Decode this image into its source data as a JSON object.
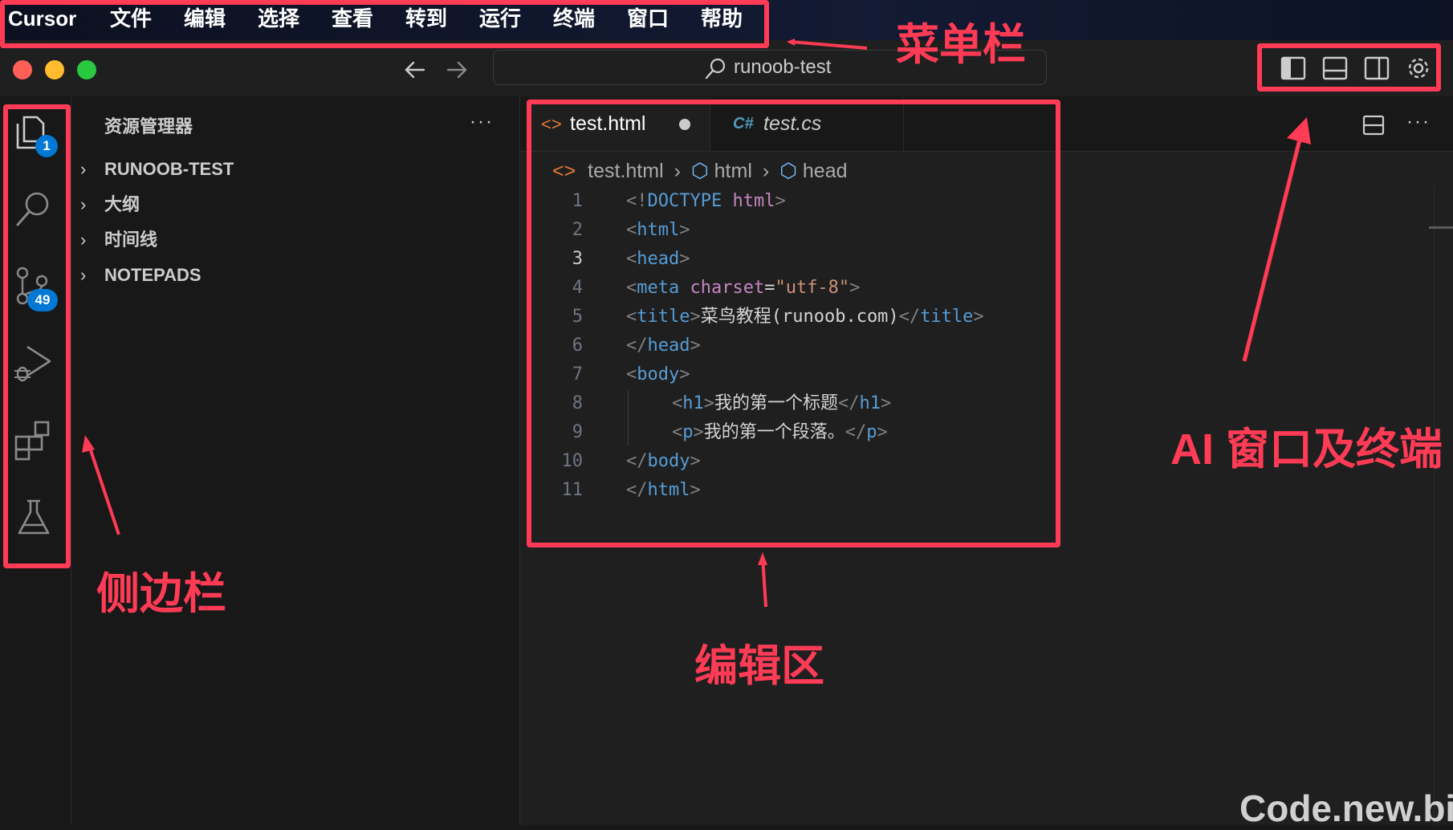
{
  "menubar": {
    "app": "Cursor",
    "items": [
      "文件",
      "编辑",
      "选择",
      "查看",
      "转到",
      "运行",
      "终端",
      "窗口",
      "帮助"
    ]
  },
  "titlebar": {
    "search_text": "runoob-test"
  },
  "activitybar": {
    "explorer_badge": "1",
    "scm_badge": "49"
  },
  "sidebar": {
    "title": "资源管理器",
    "more": "···",
    "tree": [
      "RUNOOB-TEST",
      "大纲",
      "时间线",
      "NOTEPADS"
    ]
  },
  "tabs": [
    {
      "icon": "<>",
      "label": "test.html",
      "modified": true
    },
    {
      "icon": "C#",
      "label": "test.cs",
      "modified": false
    }
  ],
  "breadcrumb": {
    "file": "test.html",
    "items": [
      "html",
      "head"
    ]
  },
  "editor": {
    "active_line": 3,
    "line_numbers": [
      "1",
      "2",
      "3",
      "4",
      "5",
      "6",
      "7",
      "8",
      "9",
      "10",
      "11"
    ],
    "title_text": "菜鸟教程(runoob.com)",
    "h1_text": "我的第一个标题",
    "p_text": "我的第一个段落。"
  },
  "annotations": {
    "menubar": "菜单栏",
    "ai_window": "AI 窗口及终端",
    "sidebar": "侧边栏",
    "editor": "编辑区"
  },
  "watermark": "Code.new.bi",
  "colors": {
    "annotation_red": "#ff3b55",
    "badge_blue": "#0078d4",
    "traffic_red": "#ff5f57",
    "traffic_yellow": "#febc2e",
    "traffic_green": "#28c840"
  }
}
